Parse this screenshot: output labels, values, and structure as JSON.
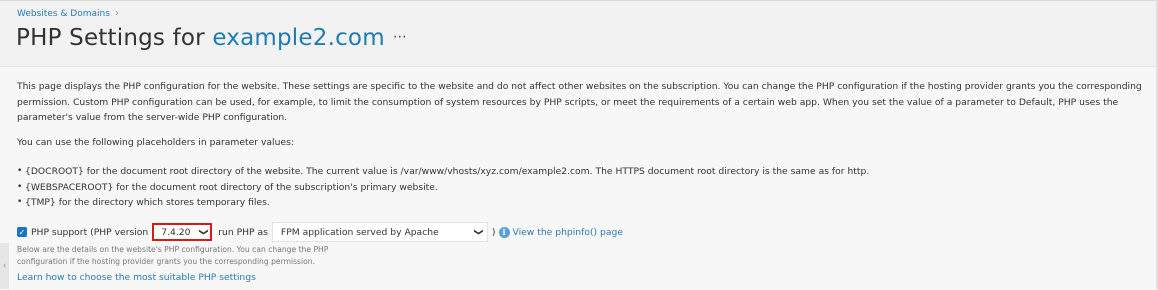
{
  "breadcrumb": {
    "link": "Websites & Domains",
    "separator": "›"
  },
  "title": {
    "prefix": "PHP Settings for ",
    "domain": "example2.com",
    "more": "⋯"
  },
  "intro": "This page displays the PHP configuration for the website. These settings are specific to the website and do not affect other websites on the subscription. You can change the PHP configuration if the hosting provider grants you the corresponding permission. Custom PHP configuration can be used, for example, to limit the consumption of system resources by PHP scripts, or meet the requirements of a certain web app. When you set the value of a parameter to Default, PHP uses the parameter's value from the server-wide PHP configuration.",
  "placeholders_intro": "You can use the following placeholders in parameter values:",
  "placeholders": [
    "{DOCROOT} for the document root directory of the website. The current value is /var/www/vhosts/xyz.com/example2.com. The HTTPS document root directory is the same as for http.",
    "{WEBSPACEROOT} for the document root directory of the subscription's primary website.",
    "{TMP} for the directory which stores temporary files."
  ],
  "php_support": {
    "checked": true,
    "label": "PHP support (PHP version",
    "version": "7.4.20",
    "run_as_label": "run PHP as",
    "mode": "FPM application served by Apache",
    "close": ")",
    "info_icon": "i",
    "phpinfo_link": "View the phpinfo() page"
  },
  "note": "Below are the details on the website's PHP configuration. You can change the PHP configuration if the hosting provider grants you the corresponding permission.",
  "learn_link": "Learn how to choose the most suitable PHP settings",
  "colors": {
    "link": "#2a7ab5",
    "accent": "#1f7cb2",
    "highlight_border": "#d51c1c",
    "checkbox": "#1a73c7"
  }
}
